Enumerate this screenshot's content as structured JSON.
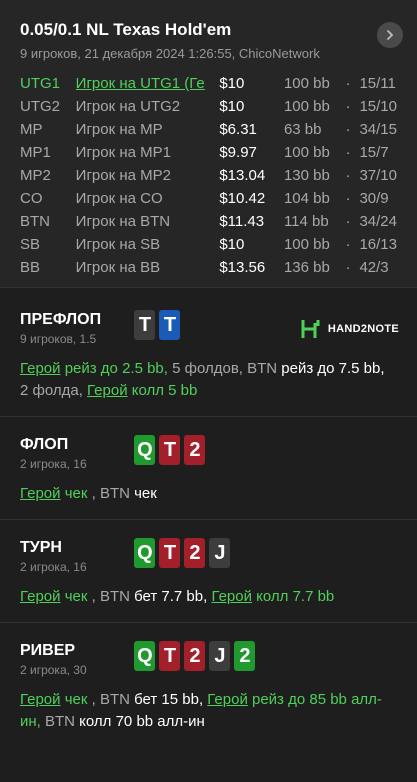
{
  "header": {
    "title": "0.05/0.1 NL Texas Hold'em",
    "subtitle": "9 игроков, 21 декабря 2024 1:26:55, ChicoNetwork"
  },
  "players": [
    {
      "pos": "UTG1",
      "name": "Игрок на UTG1 (Ге",
      "stack": "$10",
      "bb": "100 bb",
      "sep": "·",
      "ratio": "15/11",
      "hero": true
    },
    {
      "pos": "UTG2",
      "name": "Игрок на UTG2",
      "stack": "$10",
      "bb": "100 bb",
      "sep": "·",
      "ratio": "15/10",
      "hero": false
    },
    {
      "pos": "MP",
      "name": "Игрок на MP",
      "stack": "$6.31",
      "bb": "63 bb",
      "sep": "·",
      "ratio": "34/15",
      "hero": false
    },
    {
      "pos": "MP1",
      "name": "Игрок на MP1",
      "stack": "$9.97",
      "bb": "100 bb",
      "sep": "·",
      "ratio": "15/7",
      "hero": false
    },
    {
      "pos": "MP2",
      "name": "Игрок на MP2",
      "stack": "$13.04",
      "bb": "130 bb",
      "sep": "·",
      "ratio": "37/10",
      "hero": false
    },
    {
      "pos": "CO",
      "name": "Игрок на CO",
      "stack": "$10.42",
      "bb": "104 bb",
      "sep": "·",
      "ratio": "30/9",
      "hero": false
    },
    {
      "pos": "BTN",
      "name": "Игрок на BTN",
      "stack": "$11.43",
      "bb": "114 bb",
      "sep": "·",
      "ratio": "34/24",
      "hero": false
    },
    {
      "pos": "SB",
      "name": "Игрок на SB",
      "stack": "$10",
      "bb": "100 bb",
      "sep": "·",
      "ratio": "16/13",
      "hero": false
    },
    {
      "pos": "BB",
      "name": "Игрок на BB",
      "stack": "$13.56",
      "bb": "136 bb",
      "sep": "·",
      "ratio": "42/3",
      "hero": false
    }
  ],
  "logo": {
    "text": "HAND2NOTE"
  },
  "streets": {
    "preflop": {
      "name": "ПРЕФЛОП",
      "sub": "9 игроков, 1.5",
      "cards": [
        {
          "rank": "T",
          "suit": "s"
        },
        {
          "rank": "T",
          "suit": "d"
        }
      ],
      "action": [
        {
          "t": "Герой",
          "c": "gu"
        },
        {
          "t": " рейз до 2.5 bb, ",
          "c": "g"
        },
        {
          "t": "5 фолдов, ",
          "c": "gr"
        },
        {
          "t": "BTN ",
          "c": "gr"
        },
        {
          "t": "рейз до 7.5 bb, ",
          "c": "w"
        },
        {
          "t": "2 фолда, ",
          "c": "gr"
        },
        {
          "t": "Герой",
          "c": "gu"
        },
        {
          "t": " колл 5 bb",
          "c": "g"
        }
      ]
    },
    "flop": {
      "name": "ФЛОП",
      "sub": "2 игрока, 16",
      "cards": [
        {
          "rank": "Q",
          "suit": "c"
        },
        {
          "rank": "T",
          "suit": "h"
        },
        {
          "rank": "2",
          "suit": "h"
        }
      ],
      "action": [
        {
          "t": "Герой",
          "c": "gu"
        },
        {
          "t": " чек",
          "c": "g"
        },
        {
          "t": " , ",
          "c": "gr"
        },
        {
          "t": "BTN ",
          "c": "gr"
        },
        {
          "t": "чек",
          "c": "w"
        }
      ]
    },
    "turn": {
      "name": "ТУРН",
      "sub": "2 игрока, 16",
      "cards": [
        {
          "rank": "Q",
          "suit": "c"
        },
        {
          "rank": "T",
          "suit": "h"
        },
        {
          "rank": "2",
          "suit": "h"
        },
        {
          "rank": "J",
          "suit": "s"
        }
      ],
      "action": [
        {
          "t": "Герой",
          "c": "gu"
        },
        {
          "t": " чек",
          "c": "g"
        },
        {
          "t": " , ",
          "c": "gr"
        },
        {
          "t": "BTN ",
          "c": "gr"
        },
        {
          "t": "бет 7.7 bb, ",
          "c": "w"
        },
        {
          "t": "Герой",
          "c": "gu"
        },
        {
          "t": " колл 7.7 bb",
          "c": "g"
        }
      ]
    },
    "river": {
      "name": "РИВЕР",
      "sub": "2 игрока, 30",
      "cards": [
        {
          "rank": "Q",
          "suit": "c"
        },
        {
          "rank": "T",
          "suit": "h"
        },
        {
          "rank": "2",
          "suit": "h"
        },
        {
          "rank": "J",
          "suit": "s"
        },
        {
          "rank": "2",
          "suit": "c"
        }
      ],
      "action": [
        {
          "t": "Герой",
          "c": "gu"
        },
        {
          "t": " чек",
          "c": "g"
        },
        {
          "t": " , ",
          "c": "gr"
        },
        {
          "t": "BTN ",
          "c": "gr"
        },
        {
          "t": "бет 15 bb, ",
          "c": "w"
        },
        {
          "t": "Герой",
          "c": "gu"
        },
        {
          "t": " рейз до 85 bb алл-ин, ",
          "c": "g"
        },
        {
          "t": "BTN ",
          "c": "gr"
        },
        {
          "t": "колл 70 bb алл-ин",
          "c": "w"
        }
      ]
    }
  },
  "colors": {
    "hero": "#4fd05a",
    "spade": "#3d3d3d",
    "diamond": "#1a5bb8",
    "heart": "#a3202a",
    "club": "#209a2f"
  }
}
